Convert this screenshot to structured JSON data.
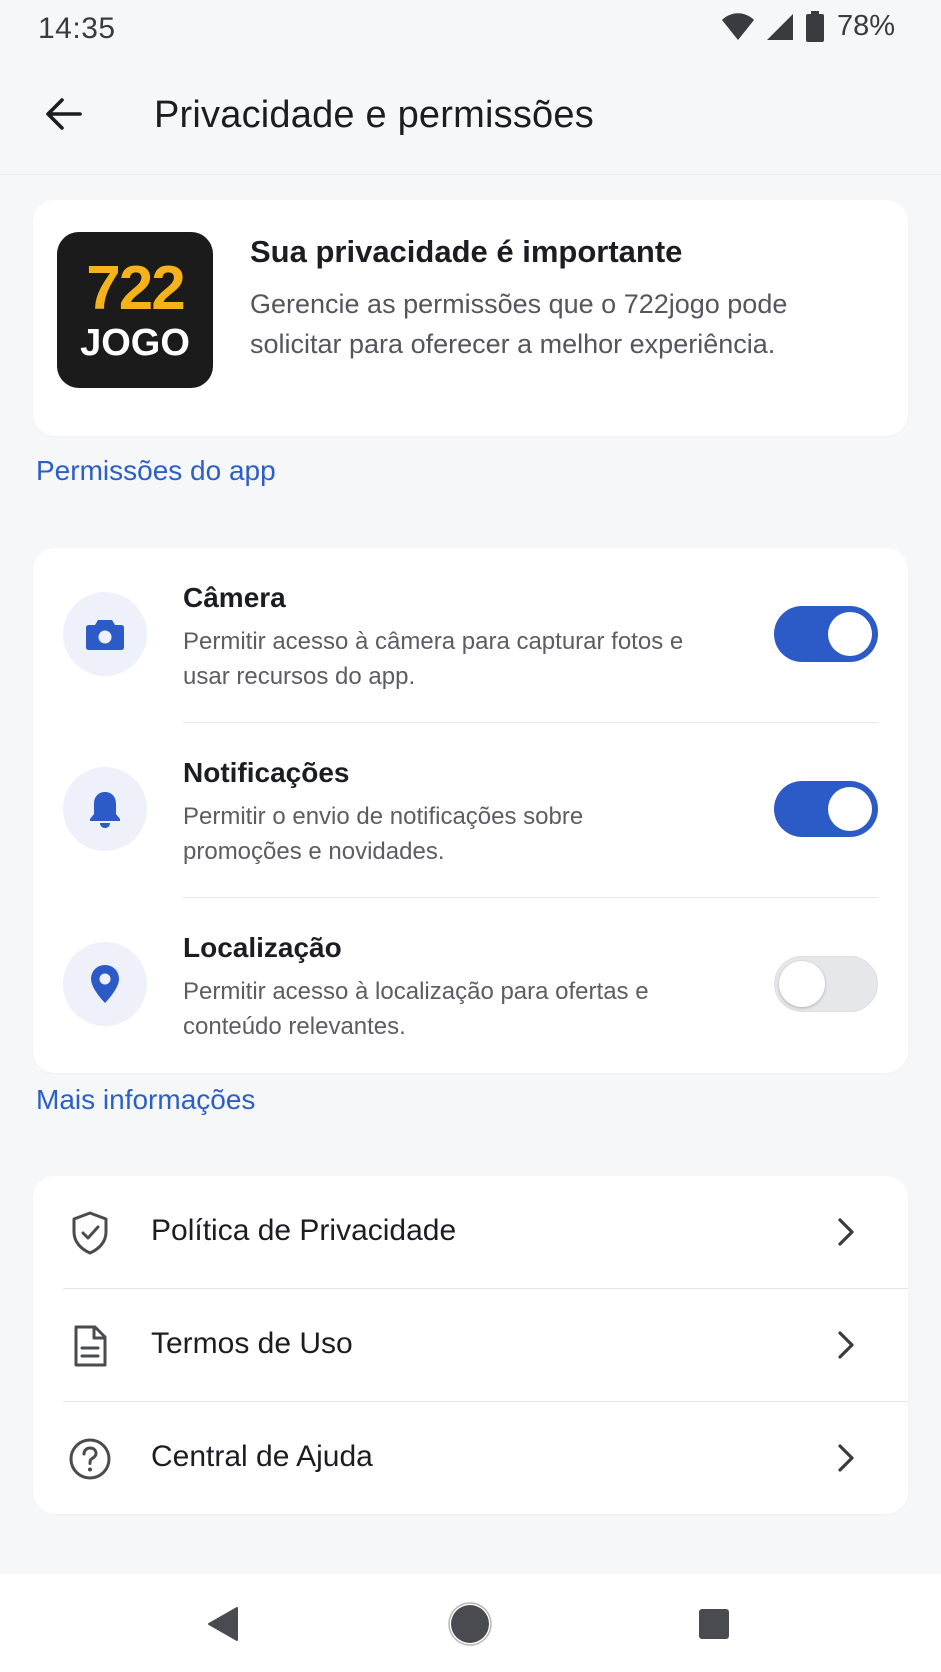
{
  "status_bar": {
    "time": "14:35",
    "battery": "78%",
    "icons": [
      "wifi-icon",
      "signal-icon",
      "battery-icon"
    ]
  },
  "app_bar": {
    "title": "Privacidade e permissões",
    "back_icon": "arrow-left-icon"
  },
  "intro": {
    "logo": {
      "number": "722",
      "word": "JOGO"
    },
    "title": "Sua privacidade é importante",
    "description": "Gerencie as permissões que o 722jogo pode solicitar para oferecer a melhor experiência."
  },
  "permissions": {
    "section_title": "Permissões do app",
    "items": [
      {
        "icon": "camera-icon",
        "title": "Câmera",
        "description": "Permitir acesso à câmera para capturar fotos e usar recursos do app.",
        "enabled": true
      },
      {
        "icon": "bell-icon",
        "title": "Notificações",
        "description": "Permitir o envio de notificações sobre promoções e novidades.",
        "enabled": true
      },
      {
        "icon": "location-pin-icon",
        "title": "Localização",
        "description": "Permitir acesso à localização para ofertas e conteúdo relevantes.",
        "enabled": false
      }
    ]
  },
  "more_info": {
    "section_title": "Mais informações",
    "items": [
      {
        "icon": "shield-check-icon",
        "label": "Política de Privacidade"
      },
      {
        "icon": "document-icon",
        "label": "Termos de Uso"
      },
      {
        "icon": "help-circle-icon",
        "label": "Central de Ajuda"
      }
    ]
  },
  "colors": {
    "accent": "#2c5bc8",
    "section_title": "#2b5fc7",
    "background": "#f6f7f9",
    "logo_yellow": "#f6b21b"
  },
  "nav_bar": {
    "icons": [
      "nav-back-icon",
      "nav-home-icon",
      "nav-recents-icon"
    ]
  }
}
